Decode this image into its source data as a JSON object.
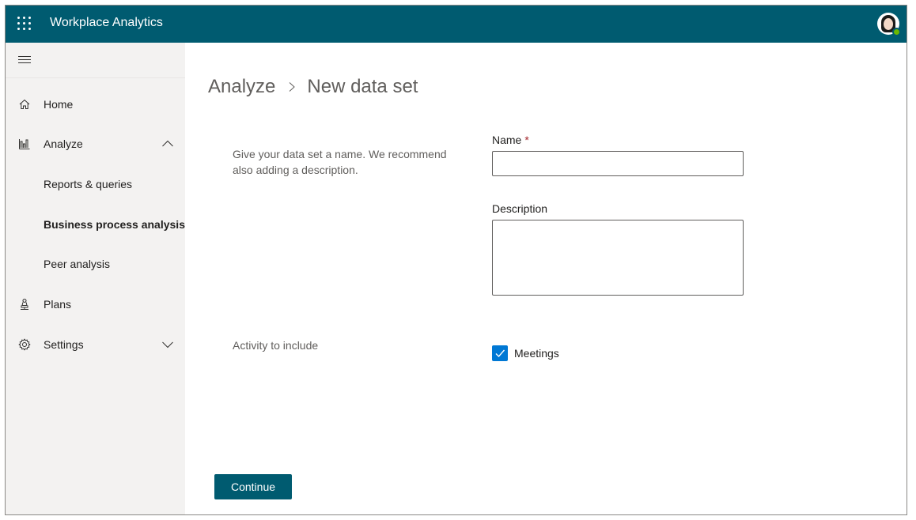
{
  "header": {
    "app_title": "Workplace Analytics",
    "waffle_icon": "app-launcher-icon",
    "avatar_icon": "user-avatar-icon",
    "presence": "available",
    "bar_color": "#005b70"
  },
  "sidebar": {
    "menu_icon": "hamburger-menu-icon",
    "items": [
      {
        "label": "Home",
        "icon": "home-icon"
      },
      {
        "label": "Analyze",
        "icon": "bar-chart-icon",
        "expanded": true,
        "children": [
          {
            "label": "Reports & queries"
          },
          {
            "label": "Business process analysis",
            "active": true
          },
          {
            "label": "Peer analysis"
          }
        ]
      },
      {
        "label": "Plans",
        "icon": "plans-icon"
      },
      {
        "label": "Settings",
        "icon": "gear-icon",
        "expanded": false
      }
    ]
  },
  "breadcrumb": {
    "parent": "Analyze",
    "separator_icon": "chevron-right-icon",
    "current": "New data set"
  },
  "form": {
    "intro_text": "Give your data set a name. We recommend also adding a description.",
    "name_label": "Name",
    "required_marker": "*",
    "name_value": "",
    "description_label": "Description",
    "description_value": "",
    "activity_label": "Activity to include",
    "activities": [
      {
        "label": "Meetings",
        "checked": true
      }
    ],
    "continue_label": "Continue"
  },
  "colors": {
    "accent": "#005b70",
    "checkbox": "#0078d4",
    "required": "#a4262c",
    "sidebar_bg": "#f3f2f1"
  }
}
